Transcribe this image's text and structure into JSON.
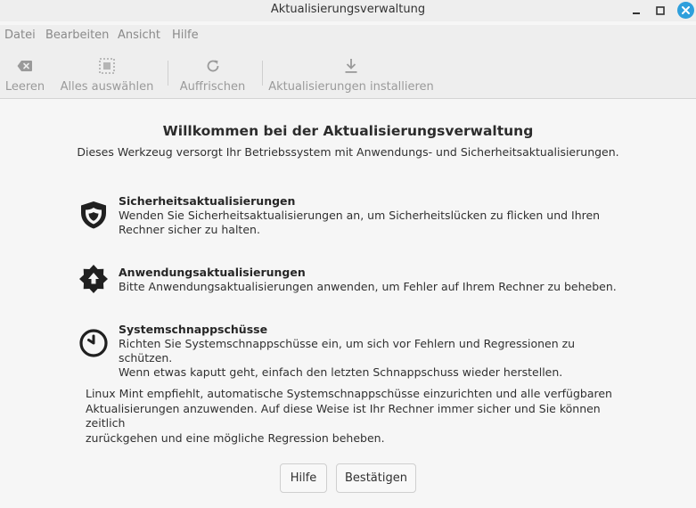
{
  "window": {
    "title": "Aktualisierungsverwaltung"
  },
  "menu": {
    "items": [
      "Datei",
      "Bearbeiten",
      "Ansicht",
      "Hilfe"
    ]
  },
  "toolbar": {
    "clear_label": "Leeren",
    "select_all_label": "Alles auswählen",
    "refresh_label": "Auffrischen",
    "install_label": "Aktualisierungen installieren"
  },
  "welcome": {
    "title": "Willkommen bei der Aktualisierungsverwaltung",
    "subtitle": "Dieses Werkzeug versorgt Ihr Betriebssystem mit Anwendungs- und Sicherheitsaktualisierungen."
  },
  "features": [
    {
      "icon": "shield-icon",
      "title": "Sicherheitsaktualisierungen",
      "desc_line1": "Wenden Sie Sicherheitsaktualisierungen an, um Sicherheitslücken zu flicken und Ihren",
      "desc_line2": "Rechner sicher zu halten."
    },
    {
      "icon": "star-upload-icon",
      "title": "Anwendungsaktualisierungen",
      "desc_line1": "Bitte Anwendungsaktualisierungen anwenden, um Fehler auf Ihrem Rechner zu beheben.",
      "desc_line2": ""
    },
    {
      "icon": "clock-icon",
      "title": "Systemschnappschüsse",
      "desc_line1": "Richten Sie Systemschnappschüsse ein, um sich vor Fehlern und Regressionen zu schützen.",
      "desc_line2": "Wenn etwas kaputt geht, einfach den letzten Schnappschuss wieder herstellen."
    }
  ],
  "recommendation": {
    "line1": "Linux Mint empfiehlt, automatische Systemschnappschüsse einzurichten und alle verfügbaren",
    "line2": "Aktualisierungen anzuwenden. Auf diese Weise ist Ihr Rechner immer sicher und Sie können zeitlich",
    "line3": "zurückgehen und eine mögliche Regression beheben."
  },
  "buttons": {
    "help": "Hilfe",
    "confirm": "Bestätigen"
  },
  "colors": {
    "close_button": "#2e9fdc",
    "disabled_text": "#9a9a9a"
  }
}
